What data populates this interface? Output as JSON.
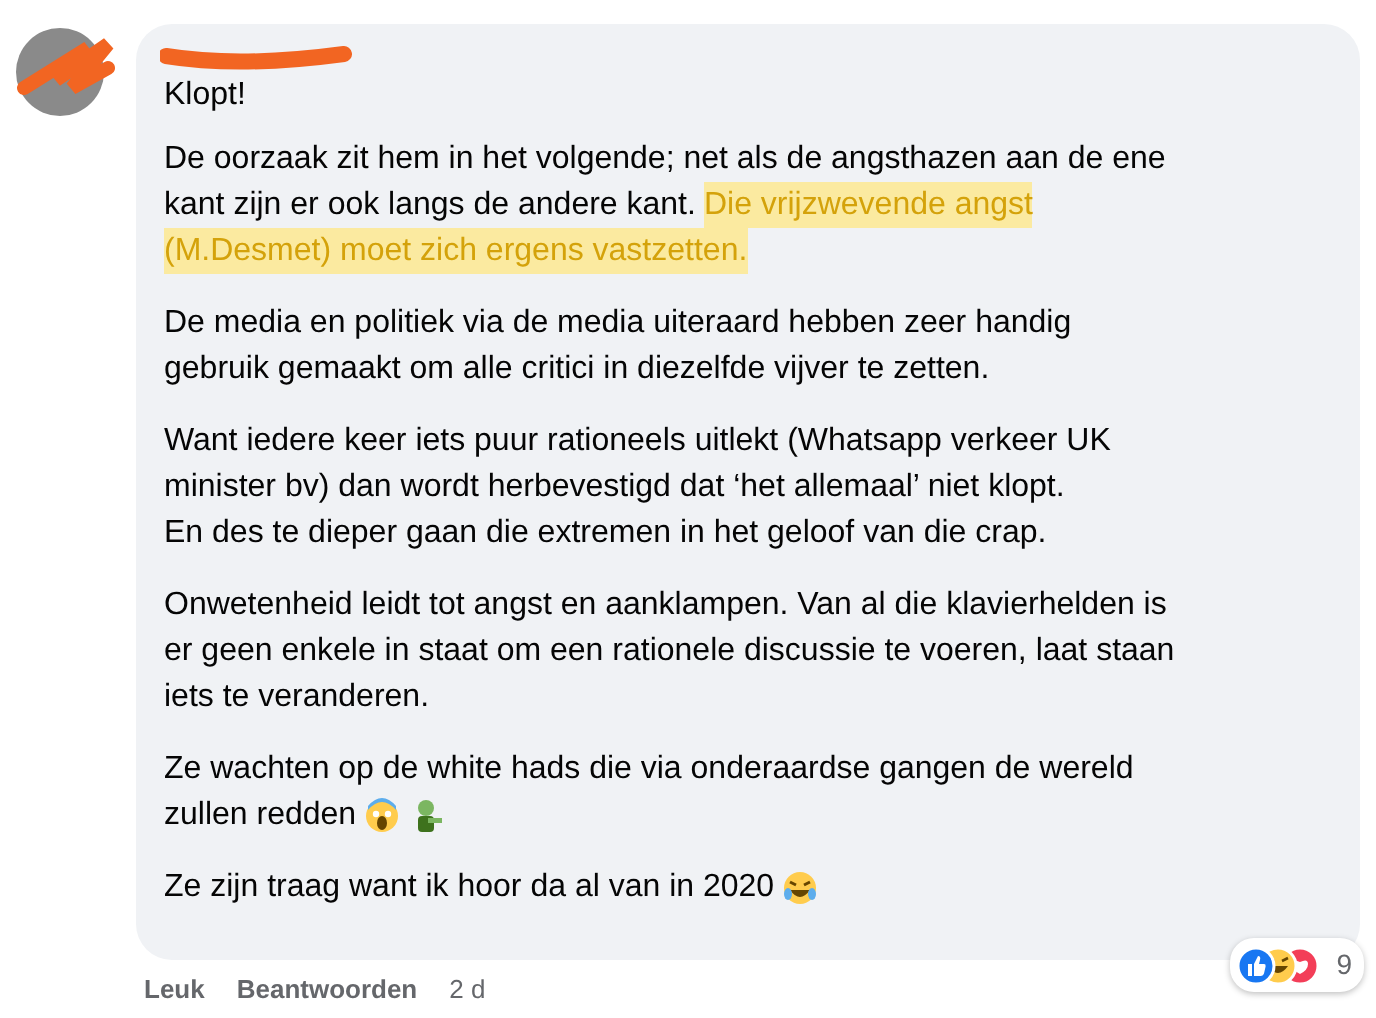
{
  "comment": {
    "first_line": "Klopt!",
    "paragraphs": [
      {
        "lines": [
          {
            "kind": "text",
            "segments": [
              {
                "text": "De oorzaak zit hem in het volgende; net als de angsthazen aan de ene",
                "highlighted": false
              }
            ]
          },
          {
            "kind": "text",
            "segments": [
              {
                "text": "kant zijn er ook langs de andere kant.",
                "highlighted": false
              },
              {
                "text": "Die vrijzwevende angst",
                "highlighted": true
              }
            ]
          },
          {
            "kind": "text",
            "segments": [
              {
                "text": "(M.Desmet) moet zich ergens vastzetten.",
                "highlighted": true
              }
            ]
          }
        ]
      },
      {
        "lines": [
          {
            "kind": "text",
            "segments": [
              {
                "text": "De media en politiek via de media uiteraard hebben zeer handig",
                "highlighted": false
              }
            ]
          },
          {
            "kind": "text",
            "segments": [
              {
                "text": "gebruik gemaakt om alle critici in diezelfde vijver te zetten.",
                "highlighted": false
              }
            ]
          }
        ]
      },
      {
        "lines": [
          {
            "kind": "text",
            "segments": [
              {
                "text": "Want iedere keer iets puur rationeels uitlekt (Whatsapp verkeer UK",
                "highlighted": false
              }
            ]
          },
          {
            "kind": "text",
            "segments": [
              {
                "text": "minister bv) dan wordt herbevestigd dat ‘het allemaal’ niet klopt.",
                "highlighted": false
              }
            ]
          },
          {
            "kind": "text",
            "segments": [
              {
                "text": "En des te dieper gaan die extremen in het geloof van die crap.",
                "highlighted": false
              }
            ]
          }
        ]
      },
      {
        "lines": [
          {
            "kind": "text",
            "segments": [
              {
                "text": "Onwetenheid leidt tot angst en aanklampen. Van al die klavierhelden is",
                "highlighted": false
              }
            ]
          },
          {
            "kind": "text",
            "segments": [
              {
                "text": "er geen enkele in staat om een rationele discussie te voeren, laat staan",
                "highlighted": false
              }
            ]
          },
          {
            "kind": "text",
            "segments": [
              {
                "text": "iets te veranderen.",
                "highlighted": false
              }
            ]
          }
        ]
      },
      {
        "lines": [
          {
            "kind": "text",
            "segments": [
              {
                "text": "Ze wachten op de white hads die via onderaardse gangen de wereld",
                "highlighted": false
              }
            ]
          },
          {
            "kind": "scream",
            "segments": [
              {
                "text": "zullen redden",
                "highlighted": false
              }
            ]
          }
        ]
      },
      {
        "lines": [
          {
            "kind": "laugh",
            "segments": [
              {
                "text": "Ze zijn traag want ik hoor da al van in 2020",
                "highlighted": false
              }
            ]
          }
        ]
      }
    ],
    "actions": [
      "Leuk",
      "Beantwoorden"
    ],
    "time": "2 d",
    "reaction_count": "9"
  }
}
